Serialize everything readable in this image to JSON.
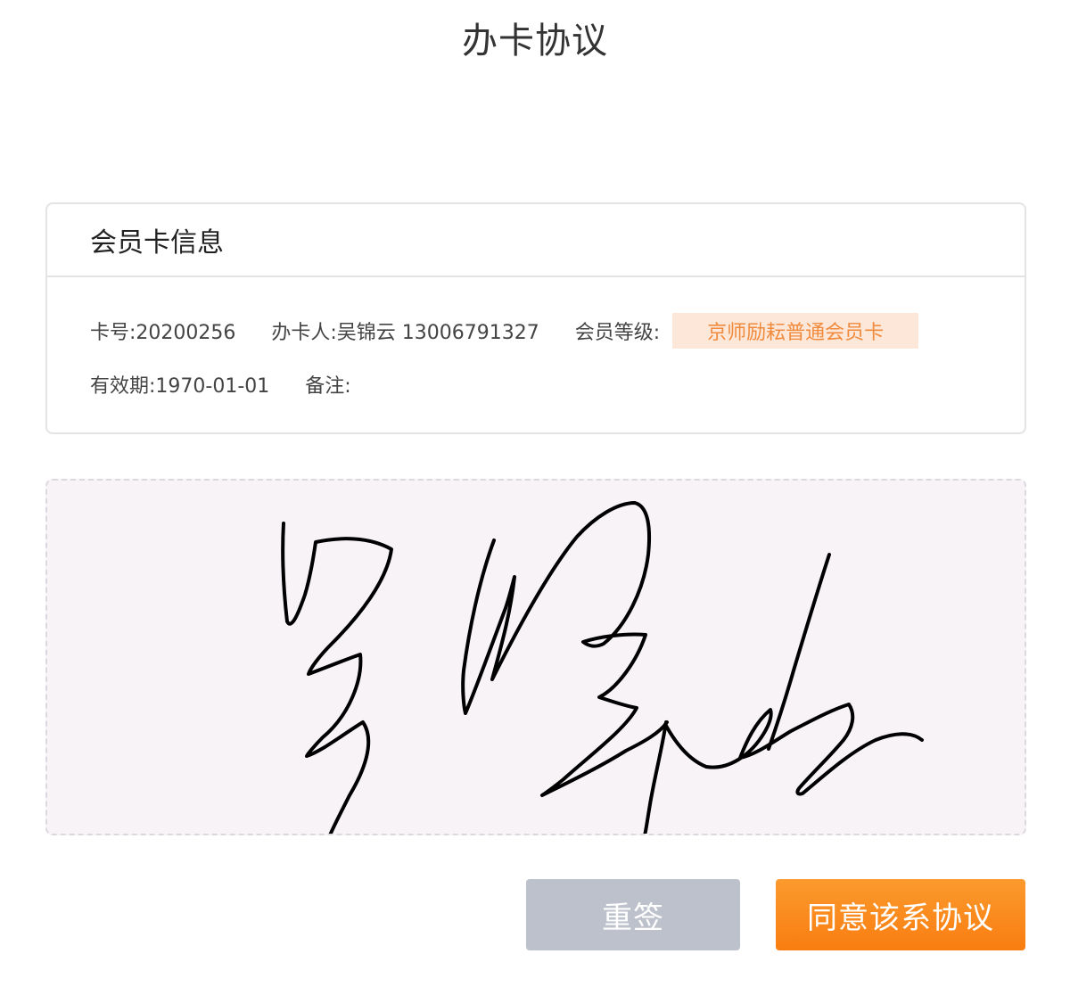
{
  "header": {
    "title": "办卡协议"
  },
  "card_info": {
    "title": "会员卡信息",
    "card_no": "卡号:20200256",
    "holder": "办卡人:吴锦云 13006791327",
    "level_label": "会员等级:",
    "level_value": "京师励耘普通会员卡",
    "valid_until": "有效期:1970-01-01",
    "remark": "备注:"
  },
  "signature": {
    "stroke_color": "#000000",
    "background_color": "#f7f3f7"
  },
  "actions": {
    "reset_label": "重签",
    "agree_label": "同意该系协议"
  },
  "colors": {
    "accent": "#f97d10",
    "badge_bg": "#fde7d8",
    "badge_text": "#f08a3c",
    "reset_bg": "#bdc1cb"
  }
}
